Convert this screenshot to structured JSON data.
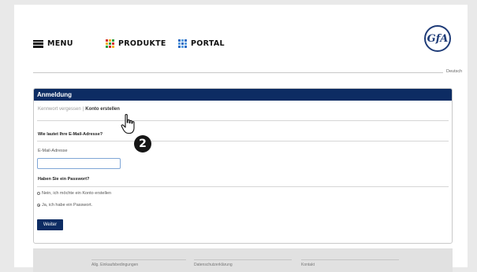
{
  "header": {
    "nav": [
      {
        "label": "MENU",
        "icon": "hamburger-menu-icon"
      },
      {
        "label": "PRODUKTE",
        "icon": "grid-icon"
      },
      {
        "label": "PORTAL",
        "icon": "grid-icon"
      }
    ],
    "logo_text": "GfA",
    "language": "Deutsch"
  },
  "login": {
    "title": "Anmeldung",
    "forgot_password": "Kennwort vergessen",
    "separator": "|",
    "create_account": "Konto erstellen",
    "email_question": "Wie lautet Ihre E-Mail-Adresse?",
    "email_label": "E-Mail-Adresse",
    "email_value": "",
    "password_question": "Haben Sie ein Passwort?",
    "options": [
      {
        "label": "Nein, ich möchte ein Konto erstellen",
        "selected": false
      },
      {
        "label": "Ja, ich habe ein Passwort.",
        "selected": true
      }
    ],
    "submit_label": "Weiter"
  },
  "footer": {
    "links": [
      "Allg. Einkaufsbedingungen",
      "Datenschutzerklärung",
      "Kontakt"
    ]
  },
  "annotation": {
    "step": "2",
    "cursor": "hand-pointer-icon"
  },
  "colors": {
    "brand_navy": "#0d2c63",
    "logo_blue": "#1f3c78",
    "grid_colors": [
      "#d22f27",
      "#f2b01e",
      "#2a9d3f",
      "#2b6cc4"
    ]
  }
}
